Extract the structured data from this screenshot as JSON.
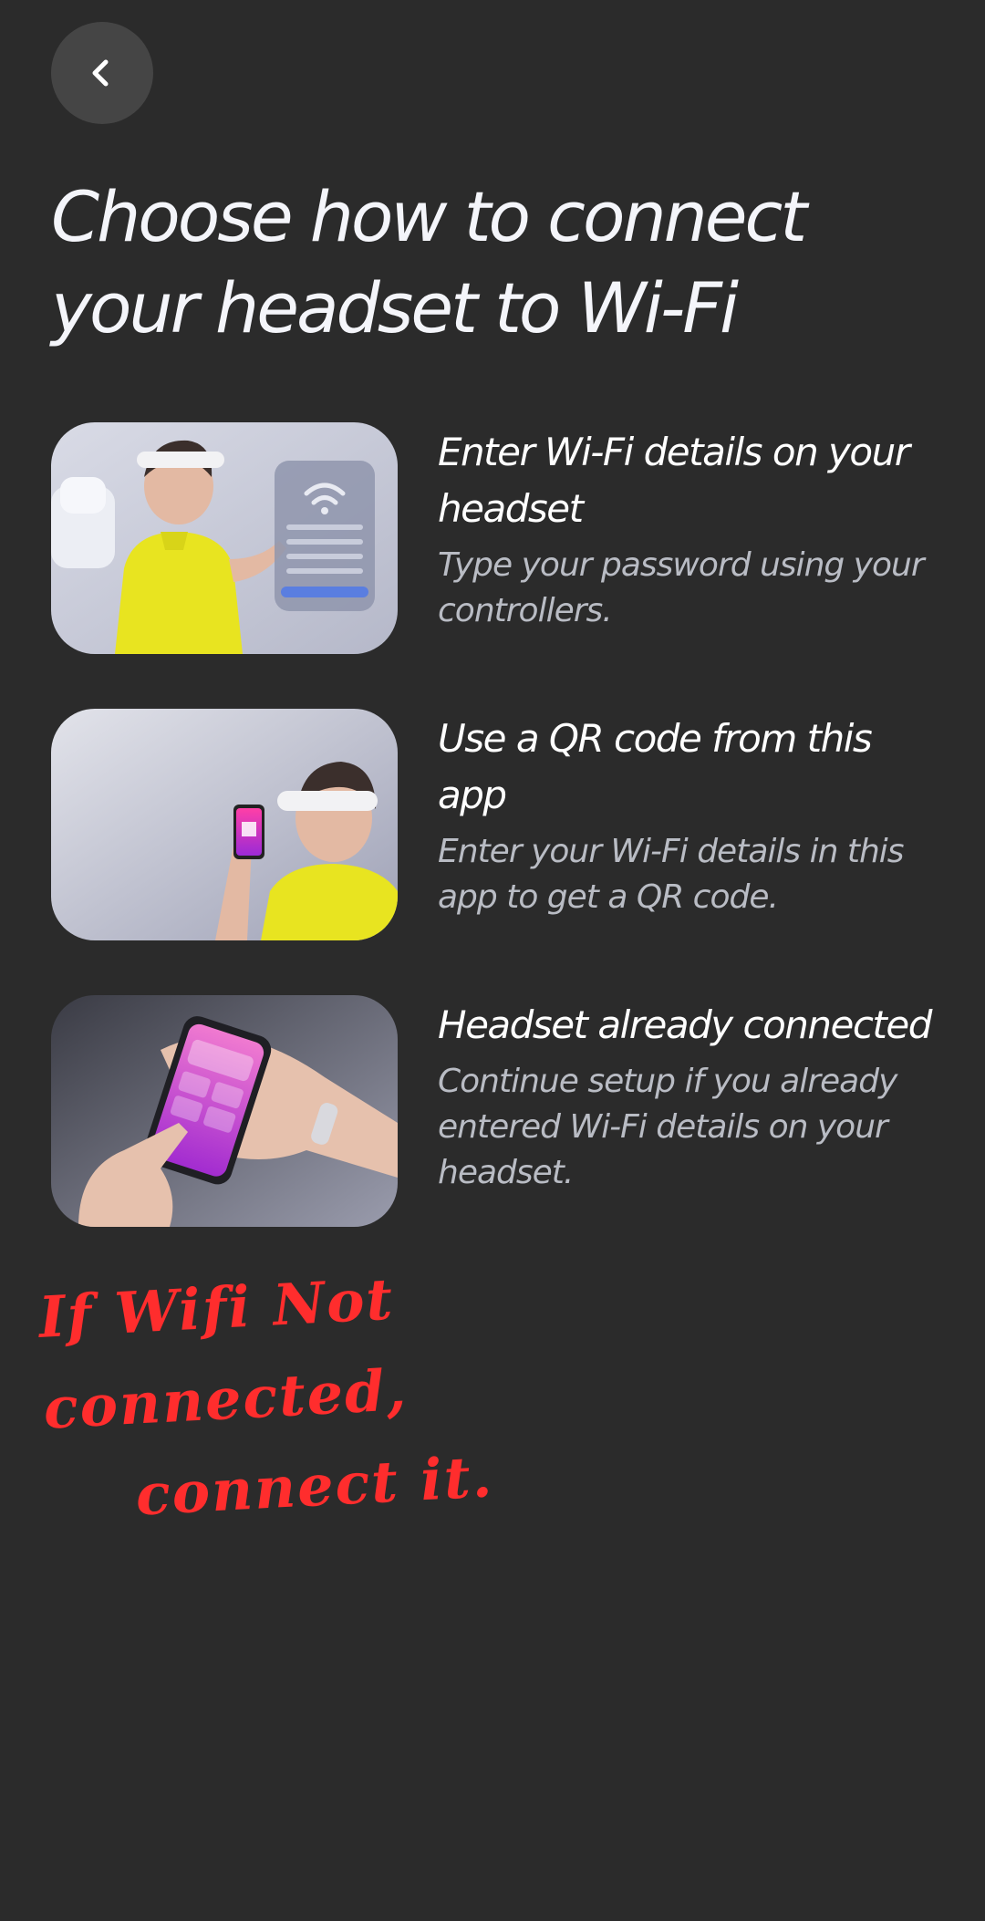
{
  "header": {
    "back_icon": "chevron-left-icon",
    "title": "Choose how to connect your headset to Wi-Fi"
  },
  "options": [
    {
      "title": "Enter Wi-Fi details on your headset",
      "description": "Type your password using your controllers."
    },
    {
      "title": "Use a QR code from this app",
      "description": "Enter your Wi-Fi details in this app to get a QR code."
    },
    {
      "title": "Headset already connected",
      "description": "Continue setup if you already entered Wi-Fi details on your headset."
    }
  ],
  "annotation": {
    "line1": "If Wifi Not connected,",
    "line2": "connect it.",
    "color": "#ff2d2d"
  },
  "colors": {
    "background": "#2b2b2b",
    "back_button": "#454545",
    "title_text": "#f4f5fa",
    "description_text": "#b9bcc4"
  }
}
